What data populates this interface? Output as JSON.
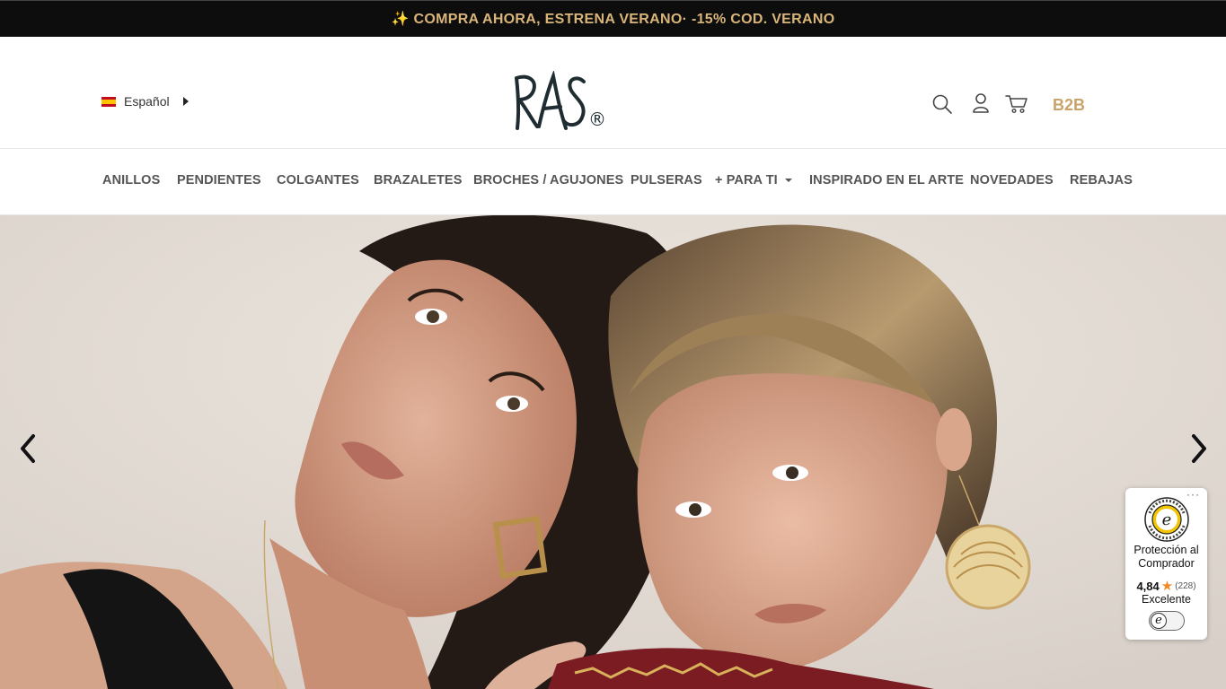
{
  "announcement": {
    "text": "✨ COMPRA AHORA, ESTRENA VERANO· -15% COD. VERANO"
  },
  "header": {
    "language": {
      "label": "Español",
      "flag": "spain-flag-icon"
    },
    "logo": {
      "text": "RAS",
      "reg": "®"
    },
    "icons": [
      "search-icon",
      "user-icon",
      "cart-icon"
    ],
    "b2b_label": "B2B",
    "accent_color": "#c9a36a"
  },
  "nav": {
    "items": [
      {
        "label": "ANILLOS"
      },
      {
        "label": "PENDIENTES"
      },
      {
        "label": "COLGANTES"
      },
      {
        "label": "BRAZALETES"
      },
      {
        "label": "BROCHES / AGUJONES"
      },
      {
        "label": "PULSERAS"
      },
      {
        "label": "+ PARA TI"
      },
      {
        "label": "INSPIRADO EN EL ARTE"
      },
      {
        "label": "NOVEDADES"
      },
      {
        "label": "REBAJAS"
      }
    ]
  },
  "hero": {
    "icons": [
      "chevron-left-icon",
      "chevron-right-icon"
    ]
  },
  "trusted_badge": {
    "title_line1": "Protección al",
    "title_line2": "Comprador",
    "score": "4,84",
    "count": "(228)",
    "grade": "Excelente",
    "dots": "···",
    "seal_icon": "trusted-shops-seal-icon",
    "toggle_letter": "e"
  }
}
